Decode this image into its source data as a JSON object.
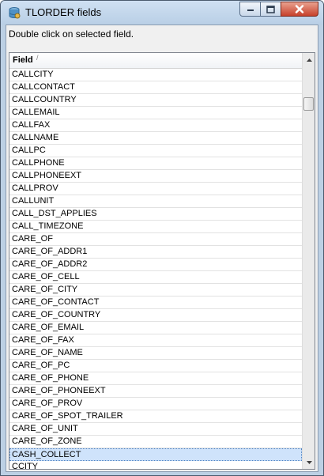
{
  "window": {
    "title": "TLORDER fields"
  },
  "hint": "Double click on selected field.",
  "grid": {
    "column_header": "Field",
    "sort_indicator": "/",
    "selected_index": 30,
    "rows": [
      "CALLCITY",
      "CALLCONTACT",
      "CALLCOUNTRY",
      "CALLEMAIL",
      "CALLFAX",
      "CALLNAME",
      "CALLPC",
      "CALLPHONE",
      "CALLPHONEEXT",
      "CALLPROV",
      "CALLUNIT",
      "CALL_DST_APPLIES",
      "CALL_TIMEZONE",
      "CARE_OF",
      "CARE_OF_ADDR1",
      "CARE_OF_ADDR2",
      "CARE_OF_CELL",
      "CARE_OF_CITY",
      "CARE_OF_CONTACT",
      "CARE_OF_COUNTRY",
      "CARE_OF_EMAIL",
      "CARE_OF_FAX",
      "CARE_OF_NAME",
      "CARE_OF_PC",
      "CARE_OF_PHONE",
      "CARE_OF_PHONEEXT",
      "CARE_OF_PROV",
      "CARE_OF_SPOT_TRAILER",
      "CARE_OF_UNIT",
      "CARE_OF_ZONE",
      "CASH_COLLECT",
      "CCITY"
    ]
  },
  "scrollbar": {
    "position_fraction": 0.12
  },
  "colors": {
    "title_bar": "#bcd0e4",
    "close_button": "#c7412b",
    "selection": "#cfe3fb"
  },
  "icons": [
    "app-icon",
    "minimize-icon",
    "maximize-icon",
    "close-icon",
    "scroll-up-arrow-icon",
    "scroll-down-arrow-icon"
  ]
}
